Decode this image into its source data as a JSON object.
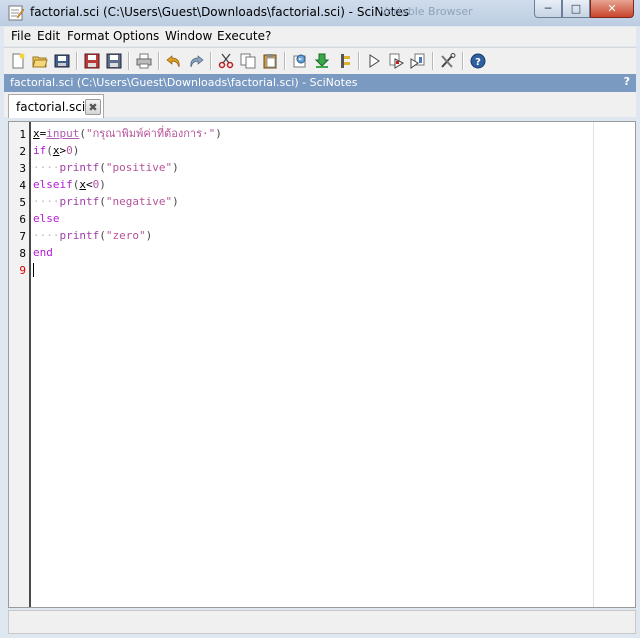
{
  "window": {
    "title": "factorial.sci (C:\\Users\\Guest\\Downloads\\factorial.sci) - SciNotes",
    "background_ghost_title": "Variable Browser"
  },
  "menubar": {
    "items": [
      "File",
      "Edit",
      "Format",
      "Options",
      "Window",
      "Execute",
      "?"
    ]
  },
  "toolbar": {
    "icons": [
      "new-file-icon",
      "open-file-icon",
      "open-folder-icon",
      "save-icon",
      "save-as-icon",
      "print-icon",
      "undo-icon",
      "redo-icon",
      "cut-icon",
      "copy-icon",
      "paste-icon",
      "execute-file-icon",
      "load-into-scilab-icon",
      "execute-selection-icon",
      "run-icon",
      "run-with-echo-icon",
      "run-until-caret-icon",
      "settings-icon",
      "help-icon"
    ]
  },
  "document_header": {
    "title": "factorial.sci (C:\\Users\\Guest\\Downloads\\factorial.sci) - SciNotes",
    "help": "?"
  },
  "tabs": [
    {
      "label": "factorial.sci"
    }
  ],
  "editor": {
    "line_numbers": [
      "1",
      "2",
      "3",
      "4",
      "5",
      "6",
      "7",
      "8",
      "9"
    ],
    "current_line": "9",
    "lines": [
      {
        "t1": "x",
        "t2": "=",
        "t3": "input",
        "t4": "(",
        "t5": "\"กรุณาพิมพ์ค่าที่ต้องการ·\"",
        "t6": ")"
      },
      {
        "t1": "if",
        "t2": "(",
        "t3": "x",
        "t4": ">",
        "t5": "0",
        "t6": ")"
      },
      {
        "t1": "····",
        "t2": "printf",
        "t3": "(",
        "t4": "\"positive\"",
        "t5": ")"
      },
      {
        "t1": "elseif",
        "t2": "(",
        "t3": "x",
        "t4": "<",
        "t5": "0",
        "t6": ")"
      },
      {
        "t1": "····",
        "t2": "printf",
        "t3": "(",
        "t4": "\"negative\"",
        "t5": ")"
      },
      {
        "t1": "else"
      },
      {
        "t1": "····",
        "t2": "printf",
        "t3": "(",
        "t4": "\"zero\"",
        "t5": ")"
      },
      {
        "t1": "end"
      }
    ]
  },
  "colors": {
    "keyword": "#b11bd4",
    "string": "#b5549a",
    "current_line_number": "#e00000",
    "header_bar": "#7a9ac1"
  }
}
